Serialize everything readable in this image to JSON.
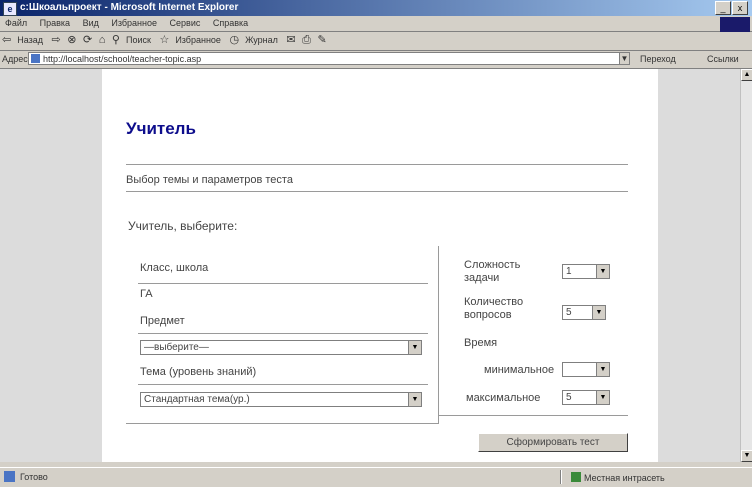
{
  "window": {
    "title": "c:Шкоальпроект - Microsoft Internet Explorer",
    "icon": "ie-page-icon",
    "controls": [
      "_",
      "x"
    ]
  },
  "menu": [
    "Файл",
    "Правка",
    "Вид",
    "Избранное",
    "Сервис",
    "Справка"
  ],
  "toolbar": {
    "back": "Назад",
    "buttons": [
      "Поиск",
      "Избранное",
      "Журнал"
    ]
  },
  "address": {
    "label": "Адрес",
    "url": "http://localhost/school/teacher-topic.asp",
    "go": "Переход",
    "links": "Ссылки"
  },
  "page": {
    "heading": "Учитель",
    "subtitle": "Выбор темы и параметров теста",
    "greeting": "Учитель, выберите:",
    "left": {
      "school_label": "Класс, школа",
      "school_value": "ГА",
      "subject_label": "Предмет",
      "subject_select": "—выберите—",
      "topic_label": "Тема (уровень знаний)",
      "topic_select": "Стандартная тема(ур.)"
    },
    "right": {
      "difficulty_label": "Сложность задачи",
      "difficulty_value": "1",
      "count_label": "Количество вопросов",
      "count_value": "5",
      "time_label": "Время",
      "time_min_label": "минимальное",
      "time_min_value": "",
      "time_max_label": "максимальное",
      "time_max_value": "5"
    },
    "submit": "Сформировать тест"
  },
  "statusbar": {
    "text": "Готово",
    "zone": "Местная интрасеть"
  },
  "colors": {
    "heading": "#0d0d8c",
    "titlebar": "#0a246a"
  }
}
